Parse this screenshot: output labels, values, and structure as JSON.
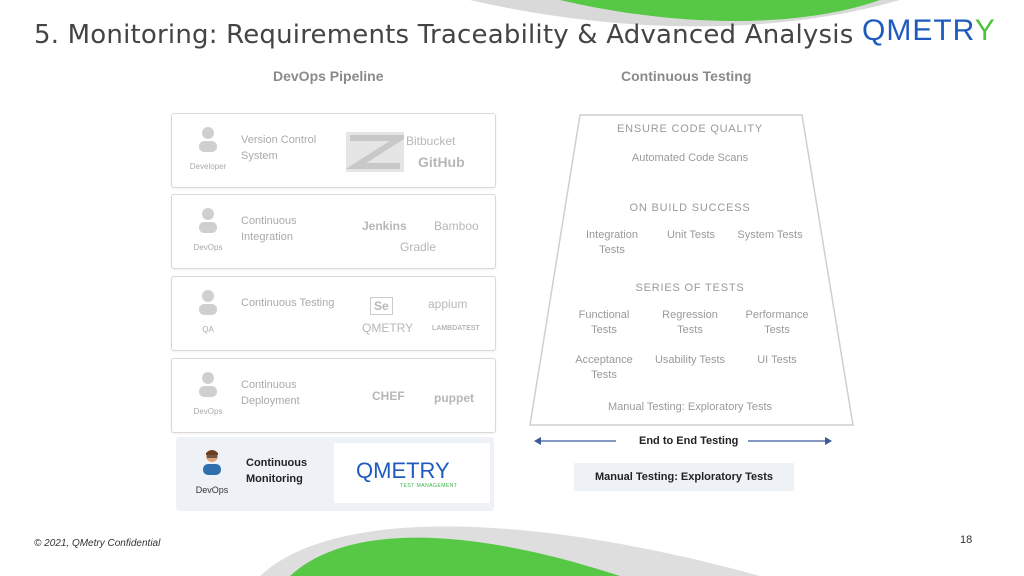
{
  "slide": {
    "title": "5. Monitoring: Requirements Traceability & Advanced Analysis",
    "logo_text": "QMETR",
    "logo_tail": "Y",
    "footer": "© 2021, QMetry Confidential",
    "page_number": "18"
  },
  "devops": {
    "heading": "DevOps Pipeline",
    "stages": [
      {
        "role": "Developer",
        "stage": "Version Control System",
        "tools": [
          "Bitbucket",
          "GitHub"
        ]
      },
      {
        "role": "DevOps",
        "stage": "Continuous Integration",
        "tools": [
          "Jenkins",
          "Bamboo",
          "Gradle"
        ]
      },
      {
        "role": "QA",
        "stage": "Continuous Testing",
        "tools": [
          "Se",
          "appium",
          "QMETRY",
          "LAMBDATEST"
        ]
      },
      {
        "role": "DevOps",
        "stage": "Continuous Deployment",
        "tools": [
          "CHEF",
          "puppet"
        ]
      },
      {
        "role": "DevOps",
        "stage": "Continuous Monitoring",
        "tools": [
          "QMETRY"
        ],
        "tool_sub": "TEST MANAGEMENT"
      }
    ]
  },
  "testing": {
    "heading": "Continuous Testing",
    "sections": [
      {
        "title": "ENSURE CODE QUALITY",
        "items": [
          "Automated Code Scans"
        ]
      },
      {
        "title": "ON BUILD SUCCESS",
        "items": [
          "Integration Tests",
          "Unit Tests",
          "System Tests"
        ]
      },
      {
        "title": "SERIES OF TESTS",
        "items": [
          "Functional Tests",
          "Regression Tests",
          "Performance Tests",
          "Acceptance Tests",
          "Usability Tests",
          "UI Tests"
        ]
      }
    ],
    "inner_manual": "Manual Testing: Exploratory Tests",
    "end_to_end": "End to End Testing",
    "manual_bottom": "Manual Testing: Exploratory Tests"
  },
  "colors": {
    "brand_blue": "#1f5bbf",
    "brand_green": "#4fc33b",
    "highlight_bg": "#eef2f7"
  }
}
